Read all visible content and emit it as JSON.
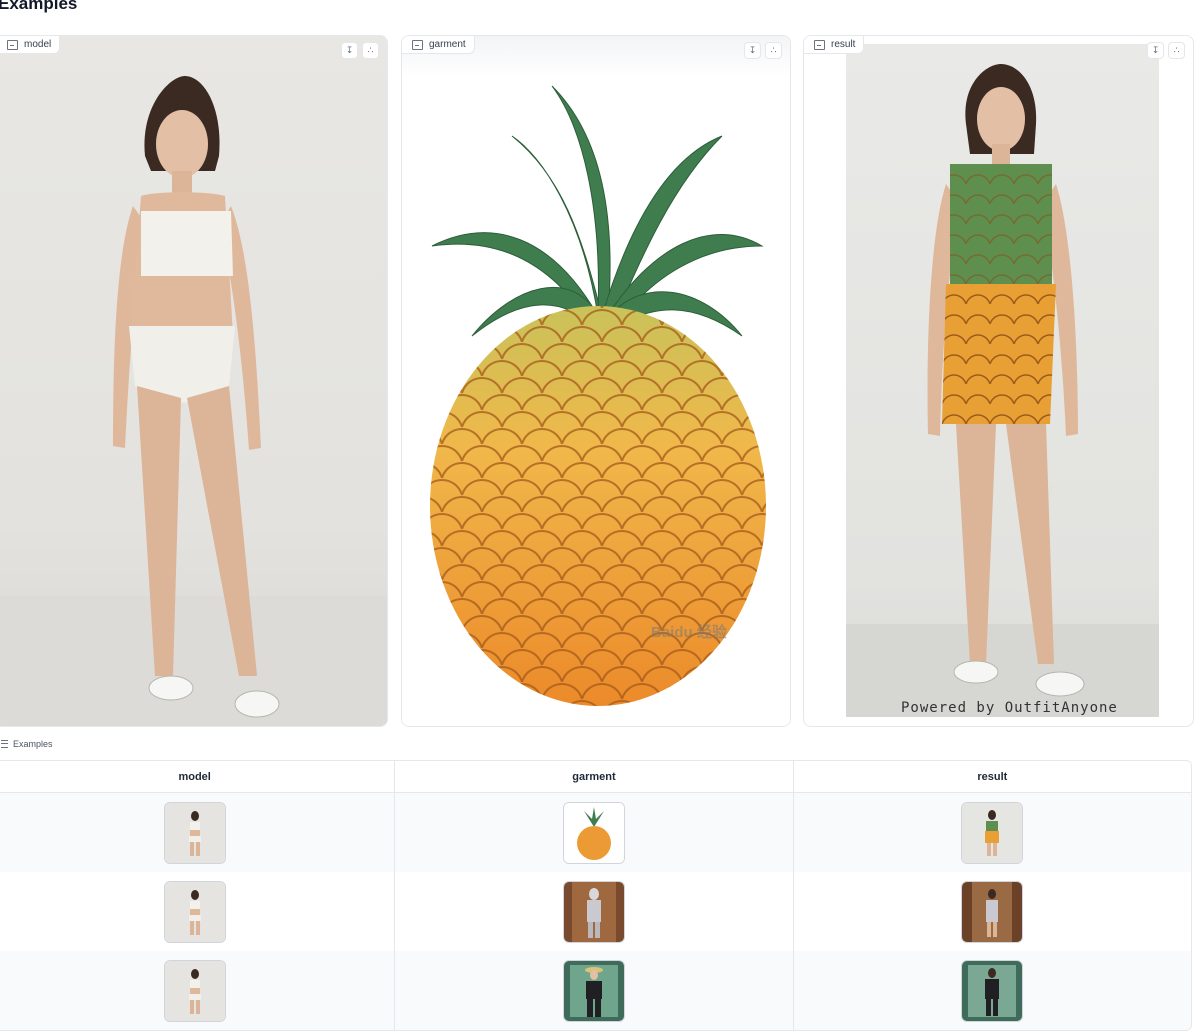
{
  "section_title": "Examples",
  "panels": {
    "model": {
      "label": "model"
    },
    "garment": {
      "label": "garment",
      "watermark": "Baidu 经验"
    },
    "result": {
      "label": "result",
      "watermark": "Powered by OutfitAnyone"
    }
  },
  "icons": {
    "image_label": "image-icon",
    "download": "download-icon",
    "share": "share-icon",
    "examples": "list-icon"
  },
  "examples": {
    "label": "Examples",
    "columns": [
      "model",
      "garment",
      "result"
    ],
    "rows": [
      {
        "model": "model in white sports bra and briefs",
        "garment": "pineapple",
        "result": "model in pineapple dress"
      },
      {
        "model": "model in white sports bra and briefs",
        "garment": "woman in silver outfit",
        "result": "model in silver outfit"
      },
      {
        "model": "model in white sports bra and briefs",
        "garment": "figure in black suit with straw hat",
        "result": "model in black suit"
      }
    ]
  },
  "colors": {
    "border": "#e5e7eb",
    "row_alt": "#f9fafb",
    "pineapple_orange": "#e8922b",
    "pineapple_leaf": "#3f7d4e"
  }
}
